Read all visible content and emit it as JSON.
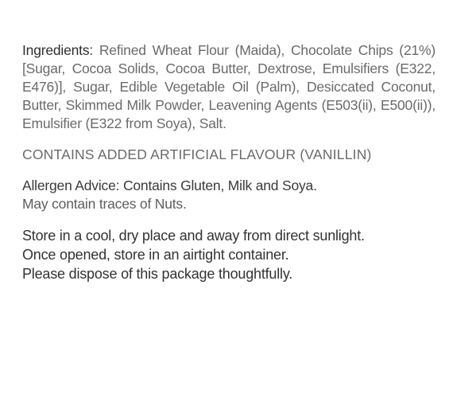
{
  "label": {
    "ingredients_heading": "Ingredients:",
    "ingredients_text": "Refined Wheat Flour (Maida), Chocolate Chips (21%) [Sugar, Cocoa Solids, Cocoa Butter, Dextrose, Emulsifiers (E322, E476)], Sugar, Edible Vegetable Oil (Palm), Desiccated Coconut, Butter, Skimmed Milk Powder, Leavening Agents (E503(ii), E500(ii)), Emulsifier (E322 from Soya), Salt.",
    "contains_notice": "CONTAINS ADDED ARTIFICIAL FLAVOUR (VANILLIN)",
    "allergen_advice": "Allergen Advice: Contains Gluten, Milk and Soya.",
    "allergen_traces": "May contain traces of Nuts.",
    "storage_lines": [
      "Store in a cool, dry place and away from direct sunlight.",
      "Once opened, store in an airtight container.",
      "Please dispose of this package thoughtfully."
    ]
  }
}
